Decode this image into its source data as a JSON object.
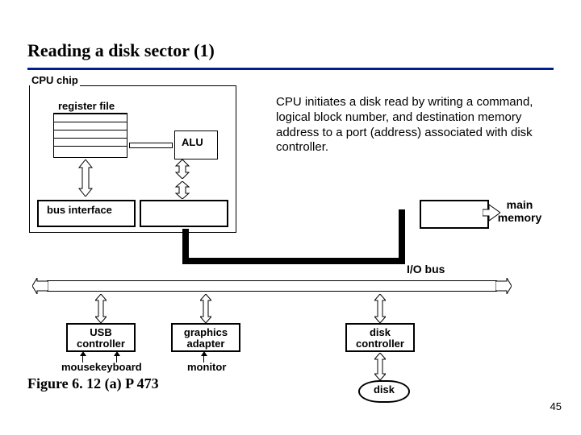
{
  "title": "Reading a disk sector (1)",
  "cpu_chip_label": "CPU chip",
  "register_file_label": "register file",
  "alu_label": "ALU",
  "bus_interface_label": "bus interface",
  "description": "CPU initiates a disk read by writing a command, logical block number, and destination memory address to a port (address) associated with disk controller.",
  "main_memory_label": "main memory",
  "io_bus_label": "I/O bus",
  "controllers": {
    "usb": "USB controller",
    "graphics": "graphics adapter",
    "disk": "disk controller"
  },
  "peripherals": {
    "mouse_keyboard": "mousekeyboard",
    "monitor": "monitor",
    "disk": "disk"
  },
  "caption": "Figure 6. 12 (a)  P 473",
  "page_number": "45",
  "colors": {
    "rule": "#001f8f",
    "text": "#000000"
  }
}
